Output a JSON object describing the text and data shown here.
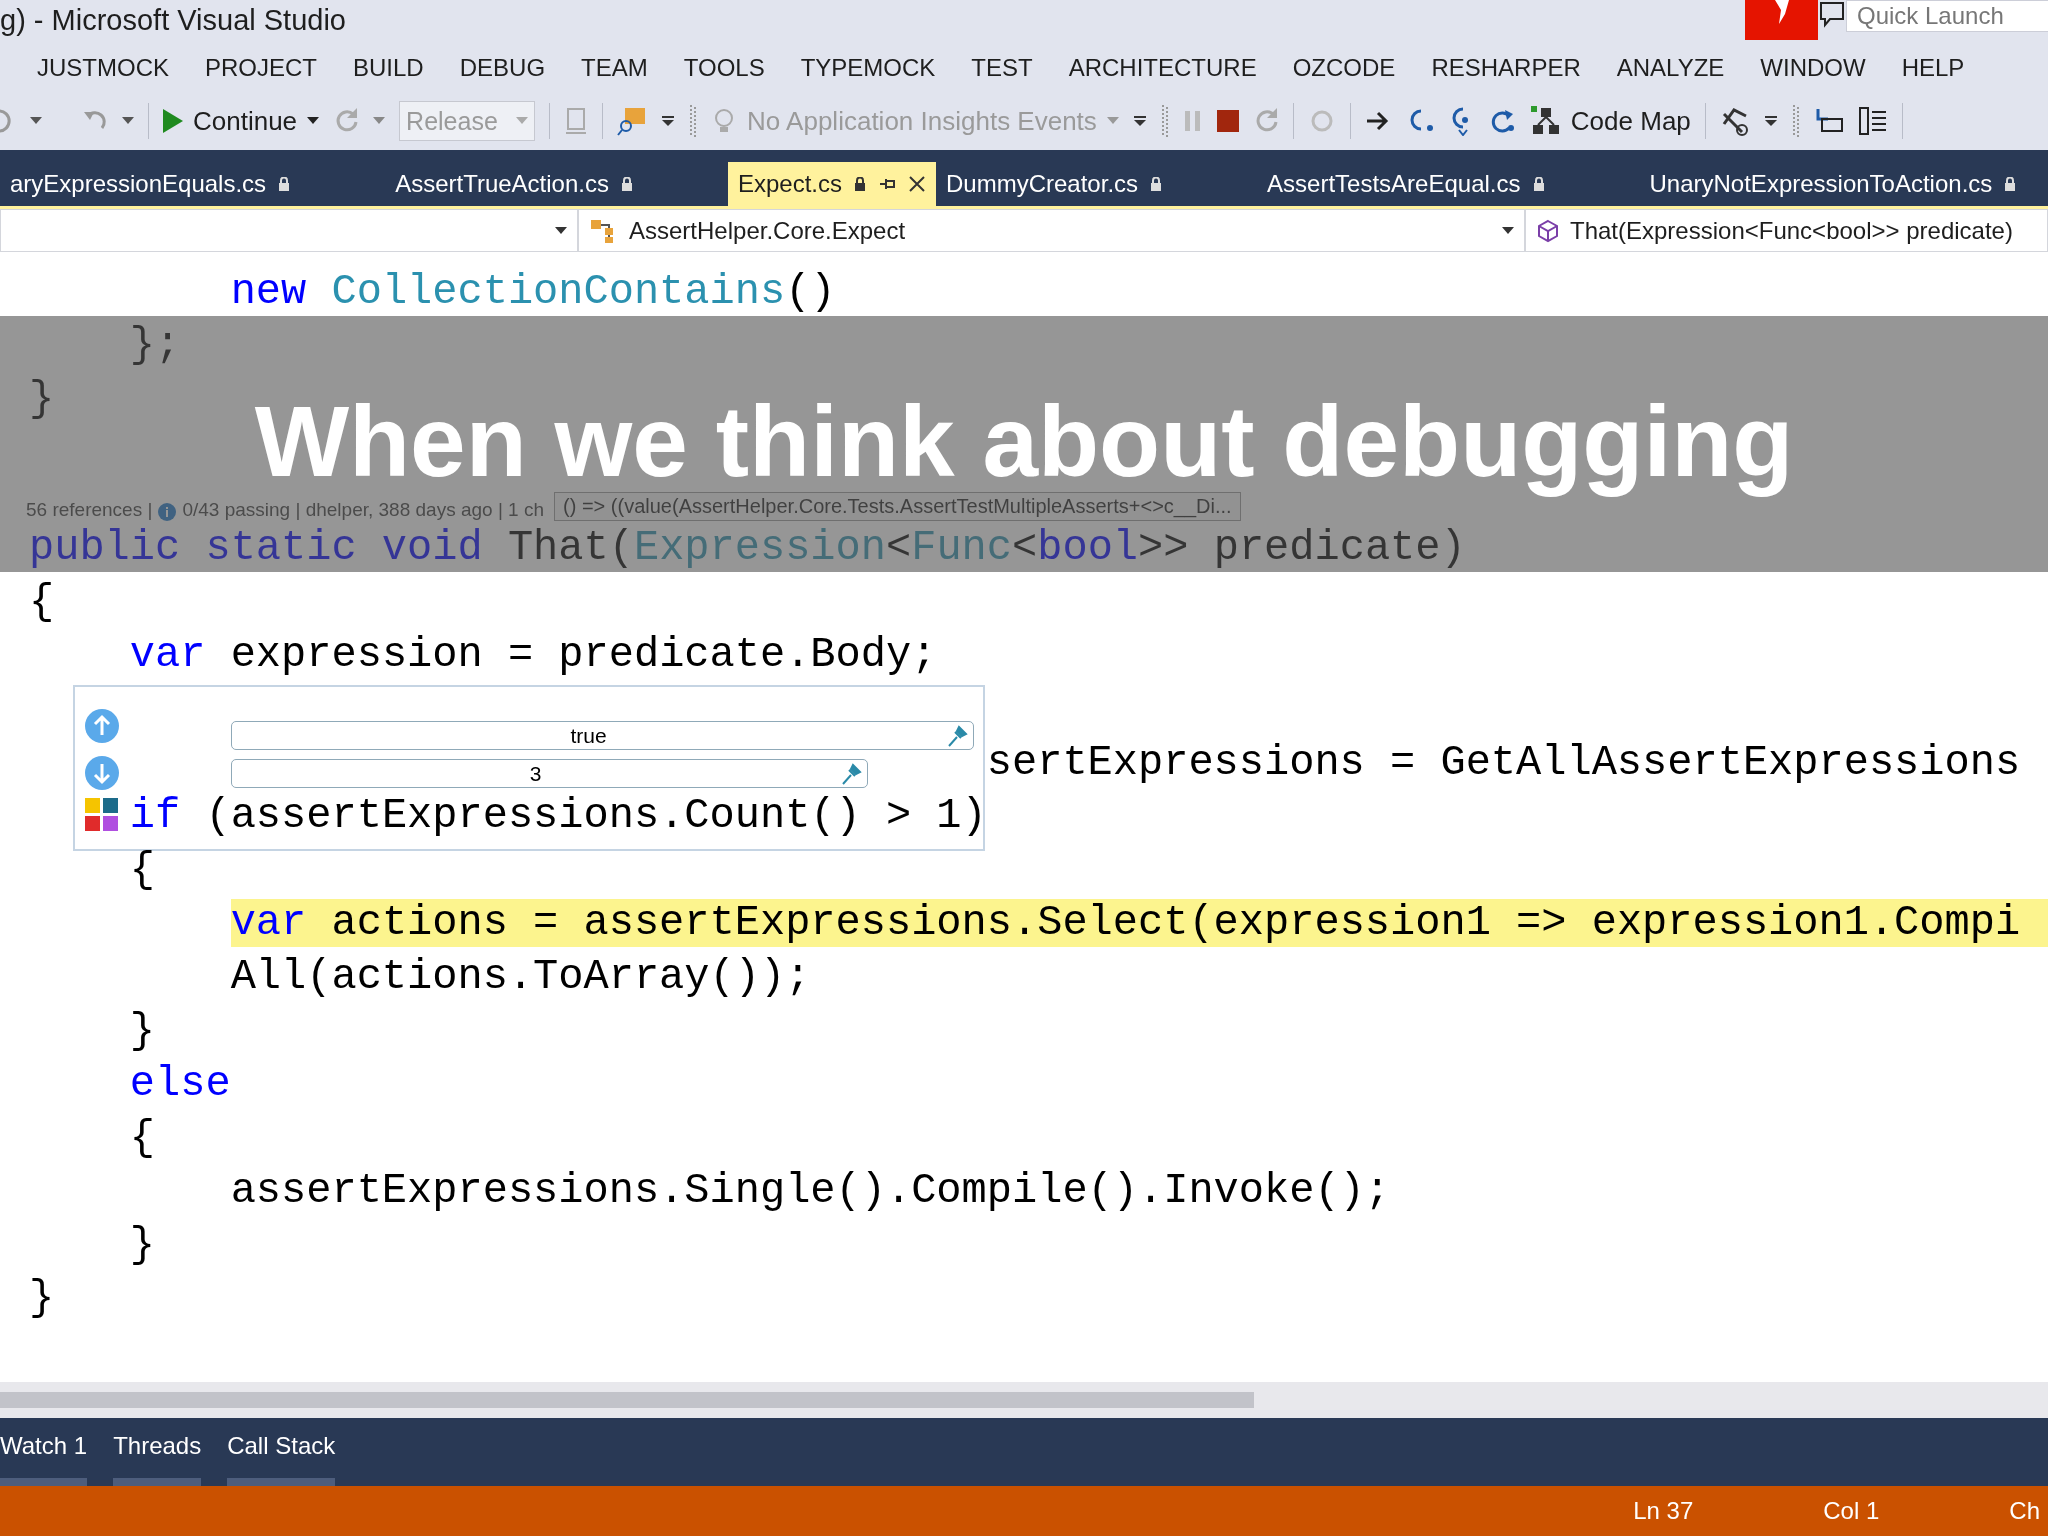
{
  "title_bar": {
    "title": "g) - Microsoft Visual Studio",
    "quick_launch": {
      "placeholder": "Quick Launch"
    }
  },
  "menu": [
    "JUSTMOCK",
    "PROJECT",
    "BUILD",
    "DEBUG",
    "TEAM",
    "TOOLS",
    "TYPEMOCK",
    "TEST",
    "ARCHITECTURE",
    "OZCODE",
    "RESHARPER",
    "ANALYZE",
    "WINDOW",
    "HELP"
  ],
  "toolbar": {
    "continue": "Continue",
    "configuration": {
      "value": "Release",
      "disabled": true
    },
    "insights": {
      "label": "No Application Insights Events",
      "disabled": true
    },
    "code_map": "Code Map"
  },
  "tabs": [
    {
      "label": "aryExpressionEquals.cs",
      "selected": false
    },
    {
      "label": "AssertTrueAction.cs",
      "selected": false
    },
    {
      "label": "Expect.cs",
      "selected": true
    },
    {
      "label": "DummyCreator.cs",
      "selected": false
    },
    {
      "label": "AssertTestsAreEqual.cs",
      "selected": false
    },
    {
      "label": "UnaryNotExpressionToAction.cs",
      "selected": false
    }
  ],
  "nav_bar": {
    "type_scope": "AssertHelper.Core.Expect",
    "member": "That(Expression<Func<bool>> predicate)"
  },
  "code_lines": [
    {
      "kind": "code",
      "highlighted": false,
      "tokens": [
        {
          "text": "        new",
          "kind": "keyword"
        },
        {
          "text": " CollectionContains",
          "kind": "type"
        },
        {
          "text": "()",
          "kind": "plain"
        }
      ]
    },
    {
      "kind": "code",
      "highlighted": false,
      "tokens": [
        {
          "text": "    };",
          "kind": "plain"
        }
      ]
    },
    {
      "kind": "code",
      "highlighted": false,
      "tokens": [
        {
          "text": "}",
          "kind": "plain"
        }
      ]
    },
    {
      "kind": "blank"
    },
    {
      "kind": "codelens",
      "references": "56 references |",
      "details": "0/43 passing | dhelper, 388 days ago | 1 ch",
      "datatip": "() => ((value(AssertHelper.Core.Tests.AssertTestMultipleAsserts+<>c__Di..."
    },
    {
      "kind": "code",
      "highlighted": false,
      "tokens": [
        {
          "text": "public static void",
          "kind": "keyword"
        },
        {
          "text": " That(",
          "kind": "plain"
        },
        {
          "text": "Expression",
          "kind": "type"
        },
        {
          "text": "<",
          "kind": "plain"
        },
        {
          "text": "Func",
          "kind": "type"
        },
        {
          "text": "<",
          "kind": "plain"
        },
        {
          "text": "bool",
          "kind": "keyword"
        },
        {
          "text": ">> predicate)",
          "kind": "plain"
        }
      ]
    },
    {
      "kind": "code",
      "highlighted": false,
      "tokens": [
        {
          "text": "{",
          "kind": "plain"
        }
      ]
    },
    {
      "kind": "code",
      "highlighted": false,
      "tokens": [
        {
          "text": "    var",
          "kind": "keyword"
        },
        {
          "text": " expression = predicate.Body;",
          "kind": "plain"
        }
      ]
    },
    {
      "kind": "blank"
    },
    {
      "kind": "code",
      "highlighted": false,
      "tokens": [
        {
          "text": "                                      sertExpressions = GetAllAssertExpressions",
          "kind": "plain"
        }
      ]
    },
    {
      "kind": "code",
      "highlighted": false,
      "tokens": [
        {
          "text": "    if",
          "kind": "keyword"
        },
        {
          "text": " (assertExpressions.Count() > 1)",
          "kind": "plain"
        }
      ]
    },
    {
      "kind": "code",
      "highlighted": false,
      "tokens": [
        {
          "text": "    {",
          "kind": "plain"
        }
      ]
    },
    {
      "kind": "code",
      "highlighted": true,
      "tokens": [
        {
          "text": "        var",
          "kind": "keyword"
        },
        {
          "text": " actions = assertExpressions.Select(expression1 => expression1.Compi",
          "kind": "plain"
        }
      ]
    },
    {
      "kind": "code",
      "highlighted": false,
      "tokens": [
        {
          "text": "        All(actions.ToArray());",
          "kind": "plain"
        }
      ]
    },
    {
      "kind": "code",
      "highlighted": false,
      "tokens": [
        {
          "text": "    }",
          "kind": "plain"
        }
      ]
    },
    {
      "kind": "code",
      "highlighted": false,
      "tokens": [
        {
          "text": "    else",
          "kind": "keyword"
        }
      ]
    },
    {
      "kind": "code",
      "highlighted": false,
      "tokens": [
        {
          "text": "    {",
          "kind": "plain"
        }
      ]
    },
    {
      "kind": "code",
      "highlighted": false,
      "tokens": [
        {
          "text": "        assertExpressions.Single().Compile().Invoke();",
          "kind": "plain"
        }
      ]
    },
    {
      "kind": "code",
      "highlighted": false,
      "tokens": [
        {
          "text": "    }",
          "kind": "plain"
        }
      ]
    },
    {
      "kind": "code",
      "highlighted": false,
      "tokens": [
        {
          "text": "}",
          "kind": "plain"
        }
      ]
    }
  ],
  "value_tooltip": {
    "values": [
      "true",
      "3"
    ]
  },
  "caption": "When we think about debugging",
  "bottom_tabs": [
    "Watch 1",
    "Threads",
    "Call Stack"
  ],
  "status_bar": [
    "Ln 37",
    "Col 1",
    "Ch"
  ]
}
